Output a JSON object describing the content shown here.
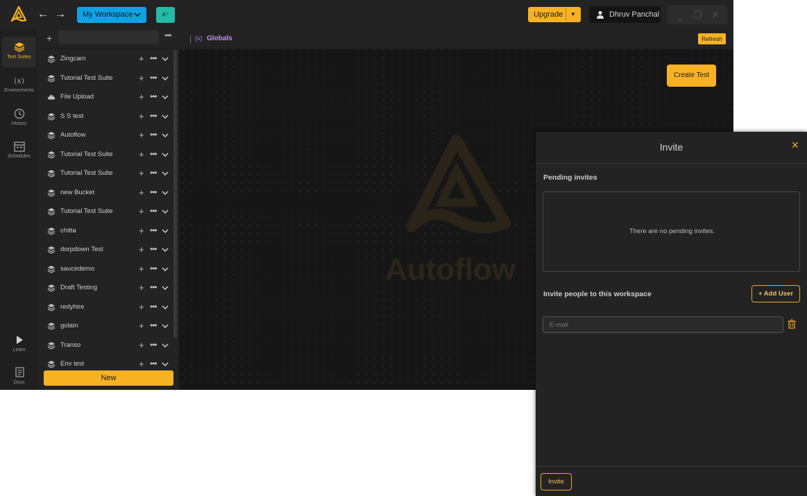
{
  "header": {
    "back_icon": "arrow-left-icon",
    "forward_icon": "arrow-right-icon",
    "workspace_label": "My Workspace",
    "ai_label": "A⁺",
    "upgrade_label": "Upgrade",
    "user_name": "Dhruv Panchal"
  },
  "rail": {
    "items": [
      {
        "label": "Test Suites",
        "icon": "layers-icon",
        "active": true
      },
      {
        "label": "Environments",
        "icon": "variable-icon"
      },
      {
        "label": "History",
        "icon": "history-icon"
      },
      {
        "label": "Schedules",
        "icon": "calendar-icon"
      }
    ],
    "bottom": [
      {
        "label": "Learn",
        "icon": "play-icon"
      },
      {
        "label": "Docs",
        "icon": "docs-icon"
      }
    ]
  },
  "suites": {
    "search_value": "",
    "items": [
      {
        "name": "Zingcam",
        "icon": "layers-icon"
      },
      {
        "name": "Tutorial Test Suite",
        "icon": "layers-icon"
      },
      {
        "name": "File Upload",
        "icon": "cloud-icon"
      },
      {
        "name": "S S test",
        "icon": "layers-icon"
      },
      {
        "name": "Autoflow",
        "icon": "layers-icon"
      },
      {
        "name": "Tutorial Test Suite",
        "icon": "layers-icon"
      },
      {
        "name": "Tutorial Test Suite",
        "icon": "layers-icon"
      },
      {
        "name": "new Bucket",
        "icon": "layers-icon"
      },
      {
        "name": "Tutorial Test Suite",
        "icon": "layers-icon"
      },
      {
        "name": "chitta",
        "icon": "layers-icon"
      },
      {
        "name": "dorpdown Test",
        "icon": "layers-icon"
      },
      {
        "name": "saucedemo",
        "icon": "layers-icon"
      },
      {
        "name": "Draft Testing",
        "icon": "layers-icon"
      },
      {
        "name": "redyhire",
        "icon": "layers-icon"
      },
      {
        "name": "golain",
        "icon": "layers-icon"
      },
      {
        "name": "Transo",
        "icon": "layers-icon"
      },
      {
        "name": "Env test",
        "icon": "layers-icon"
      }
    ],
    "new_label": "New"
  },
  "main": {
    "tab_icon_text": "(x)",
    "tab_label": "Globals",
    "refresh_label": "Refresh",
    "create_label": "Create Test",
    "watermark_text": "Autoflow"
  },
  "invite": {
    "title": "Invite",
    "pending_label": "Pending invites",
    "pending_empty": "There are no pending invites.",
    "people_label": "Invite people to this workspace",
    "add_user_label": "+ Add User",
    "email_placeholder": "E-mail",
    "invite_label": "Invite"
  },
  "colors": {
    "accent": "#f7b224",
    "workspace": "#0fa3e6",
    "ai": "#25b9a8",
    "globals": "#c78ef0"
  }
}
